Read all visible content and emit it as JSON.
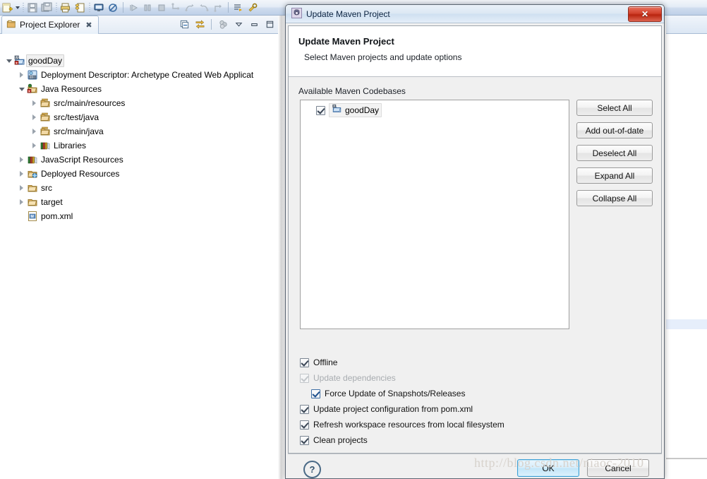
{
  "workbench": {
    "toolbar": {
      "icons": [
        "new-wizard-icon",
        "new-wizard-dropdown-icon",
        "save-icon",
        "save-all-icon",
        "print-icon",
        "quick-access-icon",
        "open-console-icon",
        "skip-breakpoints-icon",
        "resume-icon",
        "suspend-icon",
        "terminate-icon",
        "step-into-icon",
        "step-over-icon",
        "step-return-icon",
        "drop-to-frame-icon",
        "run-last-tool-icon",
        "external-tools-icon",
        "next-annotation-icon"
      ]
    },
    "explorer": {
      "tab_label": "Project Explorer",
      "tab_close": "✖",
      "view_tools": [
        "collapse-all-icon",
        "link-with-editor-icon",
        "view-menu-icon",
        "minimize-icon",
        "maximize-icon"
      ],
      "tree": [
        {
          "indent": 0,
          "state": "open",
          "icon": "maven-web-project-icon",
          "label": "goodDay",
          "selected": true
        },
        {
          "indent": 1,
          "state": "closed",
          "icon": "deployment-descriptor-icon",
          "label": "Deployment Descriptor: Archetype Created Web Applicat",
          "selected": false
        },
        {
          "indent": 1,
          "state": "open",
          "icon": "java-resources-icon",
          "label": "Java Resources",
          "selected": false
        },
        {
          "indent": 2,
          "state": "closed",
          "icon": "source-folder-icon",
          "label": "src/main/resources",
          "selected": false
        },
        {
          "indent": 2,
          "state": "closed",
          "icon": "source-folder-icon",
          "label": "src/test/java",
          "selected": false
        },
        {
          "indent": 2,
          "state": "closed",
          "icon": "source-folder-icon",
          "label": "src/main/java",
          "selected": false
        },
        {
          "indent": 2,
          "state": "closed",
          "icon": "library-icon",
          "label": "Libraries",
          "selected": false
        },
        {
          "indent": 1,
          "state": "closed",
          "icon": "library-icon",
          "label": "JavaScript Resources",
          "selected": false
        },
        {
          "indent": 1,
          "state": "closed",
          "icon": "deployed-resources-icon",
          "label": "Deployed Resources",
          "selected": false
        },
        {
          "indent": 1,
          "state": "closed",
          "icon": "folder-icon",
          "label": "src",
          "selected": false
        },
        {
          "indent": 1,
          "state": "closed",
          "icon": "folder-icon",
          "label": "target",
          "selected": false
        },
        {
          "indent": 1,
          "state": "leaf",
          "icon": "maven-pom-icon",
          "label": "pom.xml",
          "selected": false
        }
      ]
    }
  },
  "dialog": {
    "window_title": "Update Maven Project",
    "window_icon": "maven-gear-icon",
    "close_label": "✕",
    "banner": {
      "title": "Update Maven Project",
      "subtitle": "Select Maven projects and update options"
    },
    "section_label": "Available Maven Codebases",
    "codebase_tree": {
      "checked": true,
      "icon": "maven-project-folder-icon",
      "label": "goodDay"
    },
    "side_buttons": [
      {
        "name": "select-all-button",
        "label": "Select All"
      },
      {
        "name": "add-out-of-date-button",
        "label": "Add out-of-date"
      },
      {
        "name": "deselect-all-button",
        "label": "Deselect All"
      },
      {
        "name": "expand-all-button",
        "label": "Expand All"
      },
      {
        "name": "collapse-all-button",
        "label": "Collapse All"
      }
    ],
    "options": [
      {
        "name": "offline-checkbox",
        "label": "Offline",
        "checked": true,
        "disabled": false,
        "indented": false,
        "accent": false
      },
      {
        "name": "update-dependencies-checkbox",
        "label": "Update dependencies",
        "checked": true,
        "disabled": true,
        "indented": false,
        "accent": false
      },
      {
        "name": "force-update-snapshots-checkbox",
        "label": "Force Update of Snapshots/Releases",
        "checked": true,
        "disabled": false,
        "indented": true,
        "accent": true
      },
      {
        "name": "update-project-config-checkbox",
        "label": "Update project configuration from pom.xml",
        "checked": true,
        "disabled": false,
        "indented": false,
        "accent": false
      },
      {
        "name": "refresh-workspace-checkbox",
        "label": "Refresh workspace resources from local filesystem",
        "checked": true,
        "disabled": false,
        "indented": false,
        "accent": false
      },
      {
        "name": "clean-projects-checkbox",
        "label": "Clean projects",
        "checked": true,
        "disabled": false,
        "indented": false,
        "accent": false
      }
    ],
    "footer": {
      "help_label": "?",
      "ok_label": "OK",
      "cancel_label": "Cancel"
    }
  },
  "watermark": "http://blog.csdn.net/niaoc-2010",
  "colors": {
    "accent_blue": "#3c9fd6",
    "dialog_bg": "#f0f0f0",
    "close_red": "#d1412c",
    "selection_highlight": "#e6eefb"
  }
}
